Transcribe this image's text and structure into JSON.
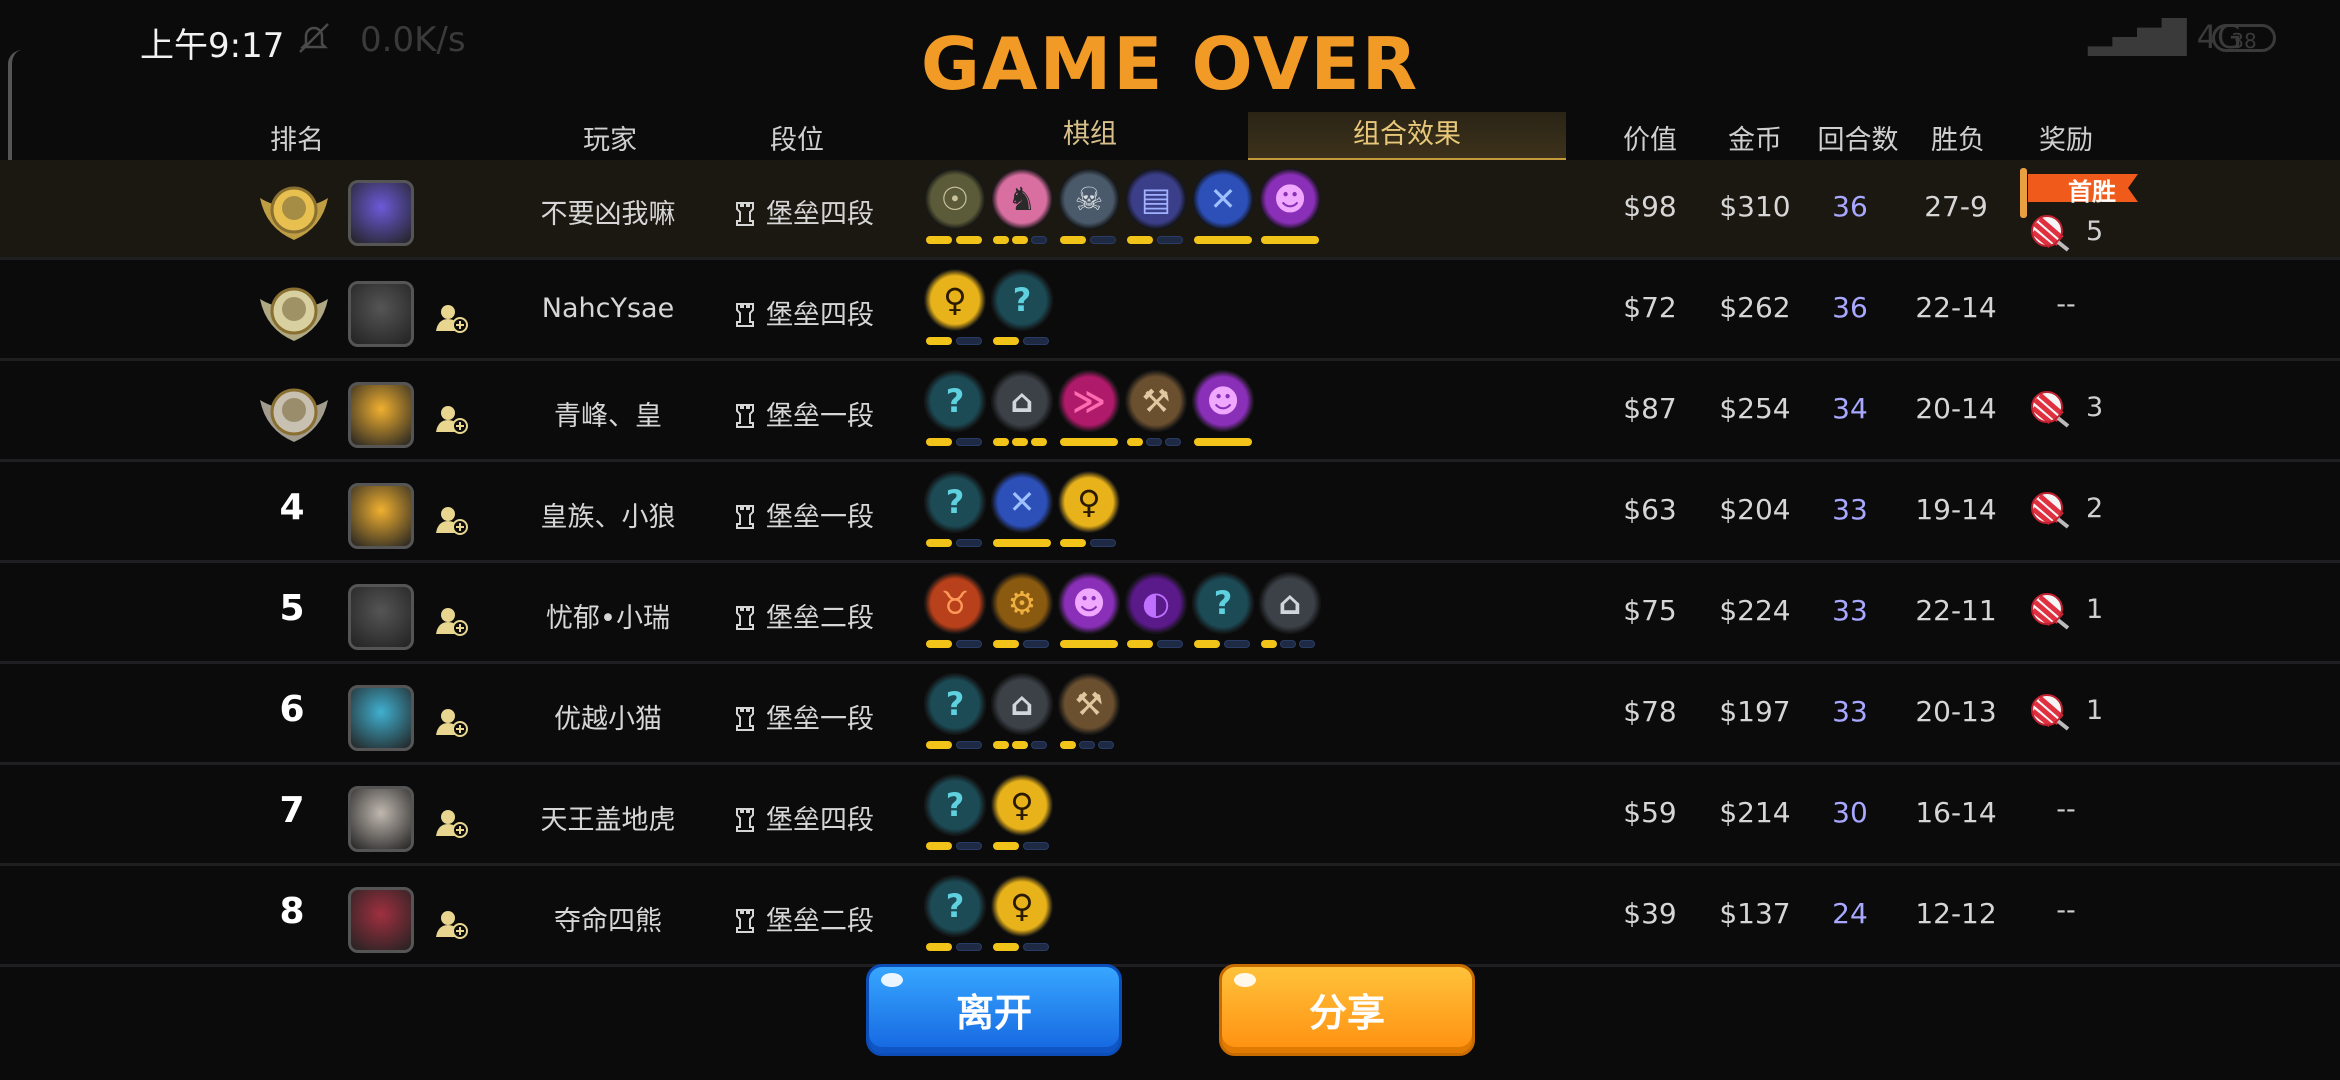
{
  "status_bar": {
    "time": "上午9:17",
    "speed": "0.0K/s",
    "network": "4G",
    "battery": "38"
  },
  "title": "GAME OVER",
  "headers": {
    "rank": "排名",
    "player": "玩家",
    "tier": "段位",
    "lineup": "棋组",
    "combo": "组合效果",
    "value": "价值",
    "gold": "金币",
    "rounds": "回合数",
    "winloss": "胜负",
    "reward": "奖励"
  },
  "first_win_badge": "首胜",
  "rows": [
    {
      "rank": "1",
      "player": "不要凶我嘛",
      "tier": "堡垒四段",
      "value": "$98",
      "gold": "$310",
      "rounds": "36",
      "wl": "27-9",
      "reward": "5",
      "synergies": [
        "olive-mask-icon",
        "knight-icon",
        "skull-icon",
        "scroll-icon",
        "hammer-blue-icon",
        "demon-purple-icon"
      ],
      "bars": [
        [
          1,
          1
        ],
        [
          1,
          1,
          0
        ],
        [
          1,
          0
        ],
        [
          1,
          0
        ],
        [
          1
        ],
        [
          1
        ]
      ]
    },
    {
      "rank": "2",
      "player": "NahcYsae",
      "tier": "堡垒四段",
      "value": "$72",
      "gold": "$262",
      "rounds": "36",
      "wl": "22-14",
      "reward": "--",
      "synergies": [
        "keyhole-gold-icon",
        "question-mark-icon"
      ],
      "bars": [
        [
          1,
          0
        ],
        [
          1,
          0
        ]
      ]
    },
    {
      "rank": "3",
      "player": "青峰、皇",
      "tier": "堡垒一段",
      "value": "$87",
      "gold": "$254",
      "rounds": "34",
      "wl": "20-14",
      "reward": "3",
      "synergies": [
        "question-mark-icon",
        "sofa-icon",
        "dragon-pink-icon",
        "axe-icon",
        "demon-purple-icon"
      ],
      "bars": [
        [
          1,
          0
        ],
        [
          1,
          1,
          1
        ],
        [
          1
        ],
        [
          1,
          0,
          0
        ],
        [
          1
        ]
      ]
    },
    {
      "rank": "4",
      "player": "皇族、小狼",
      "tier": "堡垒一段",
      "value": "$63",
      "gold": "$204",
      "rounds": "33",
      "wl": "19-14",
      "reward": "2",
      "synergies": [
        "question-mark-icon",
        "hammer-blue-icon",
        "keyhole-gold-icon"
      ],
      "bars": [
        [
          1,
          0
        ],
        [
          1
        ],
        [
          1,
          0
        ]
      ]
    },
    {
      "rank": "5",
      "player": "忧郁•小瑞",
      "tier": "堡垒二段",
      "value": "$75",
      "gold": "$224",
      "rounds": "33",
      "wl": "22-11",
      "reward": "1",
      "synergies": [
        "ogre-orange-icon",
        "gear-icon",
        "demon-purple-icon",
        "mask-purple-icon",
        "question-mark-icon",
        "sofa-icon"
      ],
      "bars": [
        [
          1,
          0
        ],
        [
          1,
          0
        ],
        [
          1
        ],
        [
          1,
          0
        ],
        [
          1,
          0
        ],
        [
          1,
          0,
          0
        ]
      ]
    },
    {
      "rank": "6",
      "player": "优越小猫",
      "tier": "堡垒一段",
      "value": "$78",
      "gold": "$197",
      "rounds": "33",
      "wl": "20-13",
      "reward": "1",
      "synergies": [
        "question-mark-icon",
        "sofa-icon",
        "axe-icon"
      ],
      "bars": [
        [
          1,
          0
        ],
        [
          1,
          1,
          0
        ],
        [
          1,
          0,
          0
        ]
      ]
    },
    {
      "rank": "7",
      "player": "天王盖地虎",
      "tier": "堡垒四段",
      "value": "$59",
      "gold": "$214",
      "rounds": "30",
      "wl": "16-14",
      "reward": "--",
      "synergies": [
        "question-mark-icon",
        "keyhole-gold-icon"
      ],
      "bars": [
        [
          1,
          0
        ],
        [
          1,
          0
        ]
      ]
    },
    {
      "rank": "8",
      "player": "夺命四熊",
      "tier": "堡垒二段",
      "value": "$39",
      "gold": "$137",
      "rounds": "24",
      "wl": "12-12",
      "reward": "--",
      "synergies": [
        "question-mark-icon",
        "keyhole-gold-icon"
      ],
      "bars": [
        [
          1,
          0
        ],
        [
          1,
          0
        ]
      ]
    }
  ],
  "buttons": {
    "leave": "离开",
    "share": "分享"
  },
  "colors": {
    "title": "#f29a26",
    "rounds": "#a8a8ff",
    "bar_on": "#f2c41a",
    "bar_off": "#1e2a44",
    "leave": "#1f7cf0",
    "share": "#ff9d1e"
  }
}
